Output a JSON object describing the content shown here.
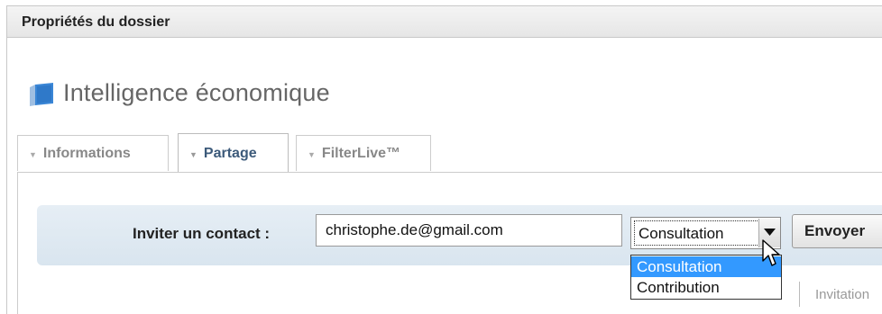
{
  "window": {
    "title": "Propriétés du dossier"
  },
  "folder": {
    "name": "Intelligence économique",
    "icon": "folder-book-icon"
  },
  "tabs": [
    {
      "label": "Informations",
      "active": false
    },
    {
      "label": "Partage",
      "active": true
    },
    {
      "label": "FilterLive™",
      "active": false
    }
  ],
  "invite": {
    "label": "Inviter un contact :",
    "email_value": "christophe.de@gmail.com",
    "role_selected": "Consultation",
    "send_label": "Envoyer"
  },
  "dropdown": {
    "options": [
      "Consultation",
      "Contribution"
    ],
    "highlighted": "Consultation"
  },
  "list_header": {
    "invitation_label": "Invitation"
  },
  "colors": {
    "invite_bar_bg": "#dde7f0",
    "active_tab_text": "#3c5a7a",
    "option_highlight": "#3399ff",
    "folder_icon": "#3a86d6"
  }
}
